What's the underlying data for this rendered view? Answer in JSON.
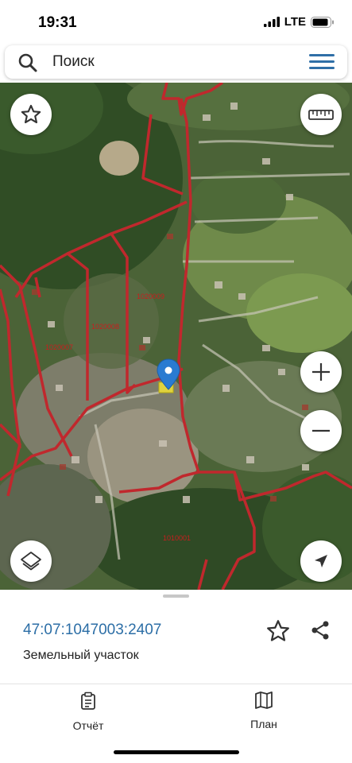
{
  "status_bar": {
    "time": "19:31",
    "network": "LTE"
  },
  "search": {
    "placeholder": "Поиск"
  },
  "map": {
    "parcel_labels": [
      "1020009",
      "1020008",
      "1020007",
      "1010001"
    ],
    "boundary_color": "#c0282d",
    "icons": [
      "star-icon",
      "ruler-icon",
      "zoom-in-icon",
      "zoom-out-icon",
      "layers-icon",
      "location-arrow-icon",
      "map-pin-icon"
    ]
  },
  "sheet": {
    "cadastral_number": "47:07:1047003:2407",
    "object_type": "Земельный участок",
    "tabs": [
      {
        "label": "Отчёт",
        "icon": "report-icon"
      },
      {
        "label": "План",
        "icon": "plan-map-icon"
      }
    ]
  },
  "colors": {
    "accent": "#2c6ea6",
    "boundary": "#c0282d",
    "highlight": "#f2e337"
  }
}
